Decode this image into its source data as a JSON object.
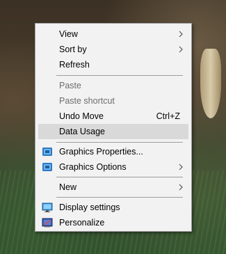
{
  "menu": {
    "items": [
      {
        "label": "View",
        "icon": "",
        "submenu": true
      },
      {
        "label": "Sort by",
        "icon": "",
        "submenu": true
      },
      {
        "label": "Refresh",
        "icon": ""
      },
      {
        "label": "Paste",
        "disabled": true
      },
      {
        "label": "Paste shortcut",
        "disabled": true
      },
      {
        "label": "Undo Move",
        "shortcut": "Ctrl+Z"
      },
      {
        "label": "Data Usage",
        "highlighted": true
      },
      {
        "label": "Graphics Properties...",
        "icon": "intel-graphics-icon"
      },
      {
        "label": "Graphics Options",
        "icon": "intel-graphics-icon",
        "submenu": true
      },
      {
        "label": "New",
        "submenu": true
      },
      {
        "label": "Display settings",
        "icon": "display-settings-icon"
      },
      {
        "label": "Personalize",
        "icon": "personalize-icon"
      }
    ]
  },
  "colors": {
    "menu_bg": "#f2f2f2",
    "highlight_bg": "#d9d9d9",
    "disabled_text": "#6d6d6d",
    "separator": "#9d9d9d"
  }
}
